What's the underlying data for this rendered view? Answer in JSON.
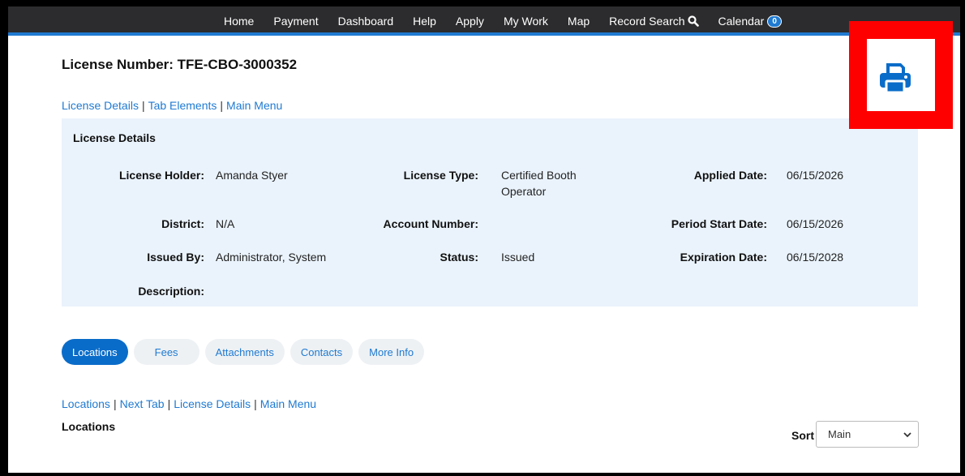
{
  "nav": {
    "items": [
      "Home",
      "Payment",
      "Dashboard",
      "Help",
      "Apply",
      "My Work",
      "Map"
    ],
    "record_search": "Record Search",
    "calendar": "Calendar",
    "calendar_count": "0"
  },
  "page": {
    "title": "License Number: TFE-CBO-3000352"
  },
  "top_links": [
    "License Details",
    "Tab Elements",
    "Main Menu"
  ],
  "details": {
    "title": "License Details",
    "license_holder_label": "License Holder:",
    "license_holder": "Amanda Styer",
    "license_type_label": "License Type:",
    "license_type_line1": "Certified Booth",
    "license_type_line2": "Operator",
    "applied_date_label": "Applied Date:",
    "applied_date": "06/15/2026",
    "district_label": "District:",
    "district": "N/A",
    "account_number_label": "Account Number:",
    "account_number": "",
    "period_start_label": "Period Start Date:",
    "period_start": "06/15/2026",
    "issued_by_label": "Issued By:",
    "issued_by": "Administrator, System",
    "status_label": "Status:",
    "status": "Issued",
    "expiration_label": "Expiration Date:",
    "expiration": "06/15/2028",
    "description_label": "Description:",
    "description": ""
  },
  "tabs": [
    "Locations",
    "Fees",
    "Attachments",
    "Contacts",
    "More Info"
  ],
  "bottom_links": [
    "Locations",
    "Next Tab",
    "License Details",
    "Main Menu"
  ],
  "section": {
    "title": "Locations",
    "sort_label": "Sort",
    "sort_value": "Main"
  },
  "colors": {
    "accent": "#1f7ad1",
    "highlight": "#ff0000"
  },
  "icons": [
    "search-icon",
    "printer-icon",
    "chevron-down-icon"
  ]
}
